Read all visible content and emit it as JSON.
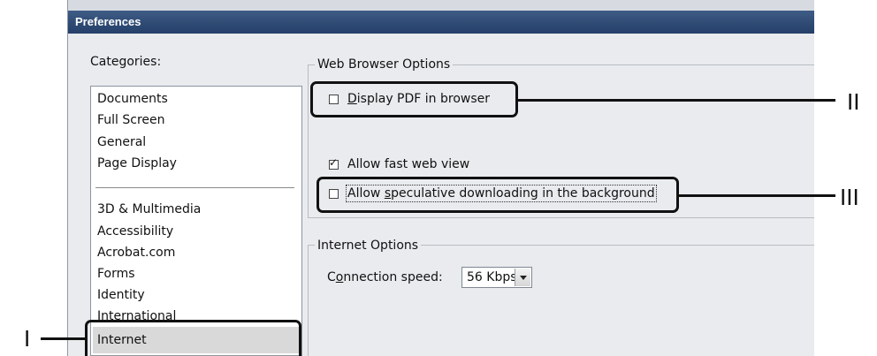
{
  "window": {
    "title": "Preferences"
  },
  "categories": {
    "label": "Categories:",
    "group1": [
      "Documents",
      "Full Screen",
      "General",
      "Page Display"
    ],
    "group2": [
      "3D & Multimedia",
      "Accessibility",
      "Acrobat.com",
      "Forms",
      "Identity",
      "International"
    ],
    "selected": "Internet"
  },
  "web_browser_options": {
    "title": "Web Browser Options",
    "display_pdf": {
      "access_key": "D",
      "rest": "isplay PDF in browser",
      "checked": false
    },
    "fast_web_view": {
      "label": "Allow fast web view",
      "checked": true
    },
    "speculative": {
      "prefix": "Allow ",
      "access_key": "s",
      "rest": "peculative downloading in the background",
      "checked": false
    }
  },
  "internet_options": {
    "title": "Internet Options",
    "connection_speed": {
      "prefix": "C",
      "access_key": "o",
      "rest": "nnection speed:",
      "value": "56 Kbps"
    }
  },
  "callouts": {
    "one": "I",
    "two": "II",
    "three": "III"
  }
}
